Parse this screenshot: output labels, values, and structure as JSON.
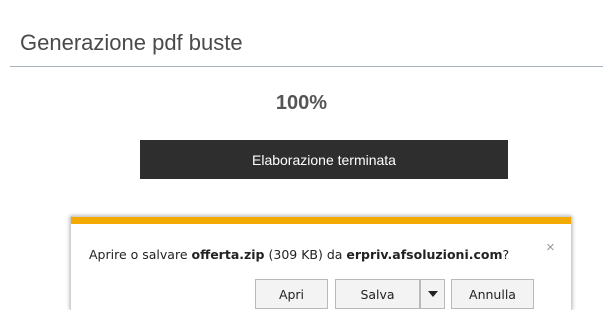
{
  "page": {
    "title": "Generazione pdf buste",
    "progress_percent": "100%",
    "progress_value": 1.0,
    "status_text": "Elaborazione terminata"
  },
  "download_bar": {
    "message_prefix": "Aprire o salvare ",
    "file_name": "offerta.zip",
    "file_size": " (309 KB) da ",
    "site": "erpriv.afsoluzioni.com",
    "message_suffix": "?",
    "close_icon": "close-icon",
    "close_glyph": "×",
    "buttons": {
      "open_label": "Apri",
      "save_label": "Salva",
      "cancel_label": "Annulla"
    },
    "accent_color": "#f2a900"
  }
}
